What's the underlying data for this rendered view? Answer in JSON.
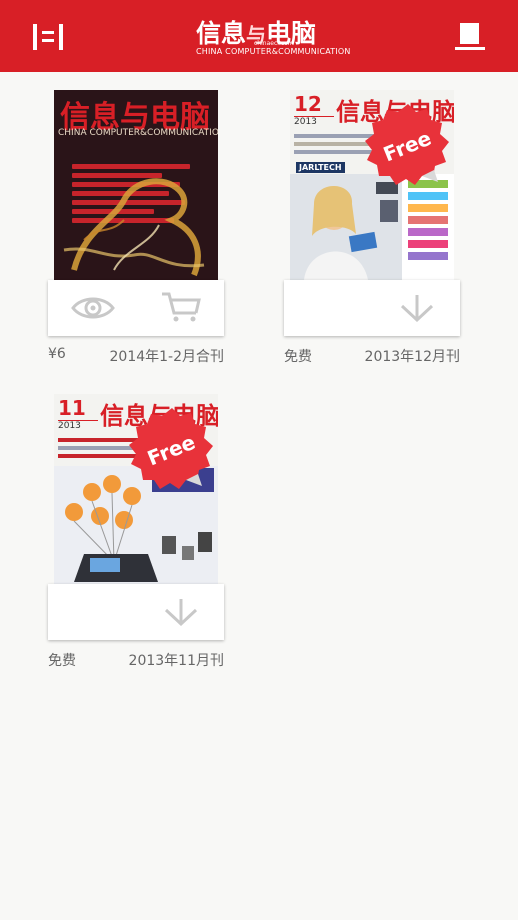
{
  "header": {
    "logo_cn_part1": "信息",
    "logo_cn_link": "与",
    "logo_cn_part2": "电脑",
    "logo_url": "chinaeci.com",
    "logo_en": "CHINA COMPUTER&COMMUNICATION",
    "menu_icon": "menu-icon",
    "shelf_icon": "bookshelf-icon"
  },
  "colors": {
    "brand_red": "#d81f26",
    "text_gray": "#666666",
    "icon_gray": "#c8c8c8",
    "background": "#f8f8f6"
  },
  "magazines": [
    {
      "price": "¥6",
      "issue": "2014年1-2月合刊",
      "free": false,
      "actions": [
        "eye-icon",
        "cart-icon"
      ],
      "cover": {
        "title": "信息与电脑",
        "subtitle": "CHINA COMPUTER&COMMUNICATION"
      }
    },
    {
      "price": "免费",
      "issue": "2013年12月刊",
      "free": true,
      "badge": "Free",
      "actions": [
        "download-icon"
      ],
      "cover": {
        "number": "12",
        "year": "2013",
        "title": "信息与电脑",
        "banner": "JARLTECH"
      }
    },
    {
      "price": "免费",
      "issue": "2013年11月刊",
      "free": true,
      "badge": "Free",
      "actions": [
        "download-icon"
      ],
      "cover": {
        "number": "11",
        "year": "2013",
        "title": "信息与电脑"
      }
    }
  ]
}
